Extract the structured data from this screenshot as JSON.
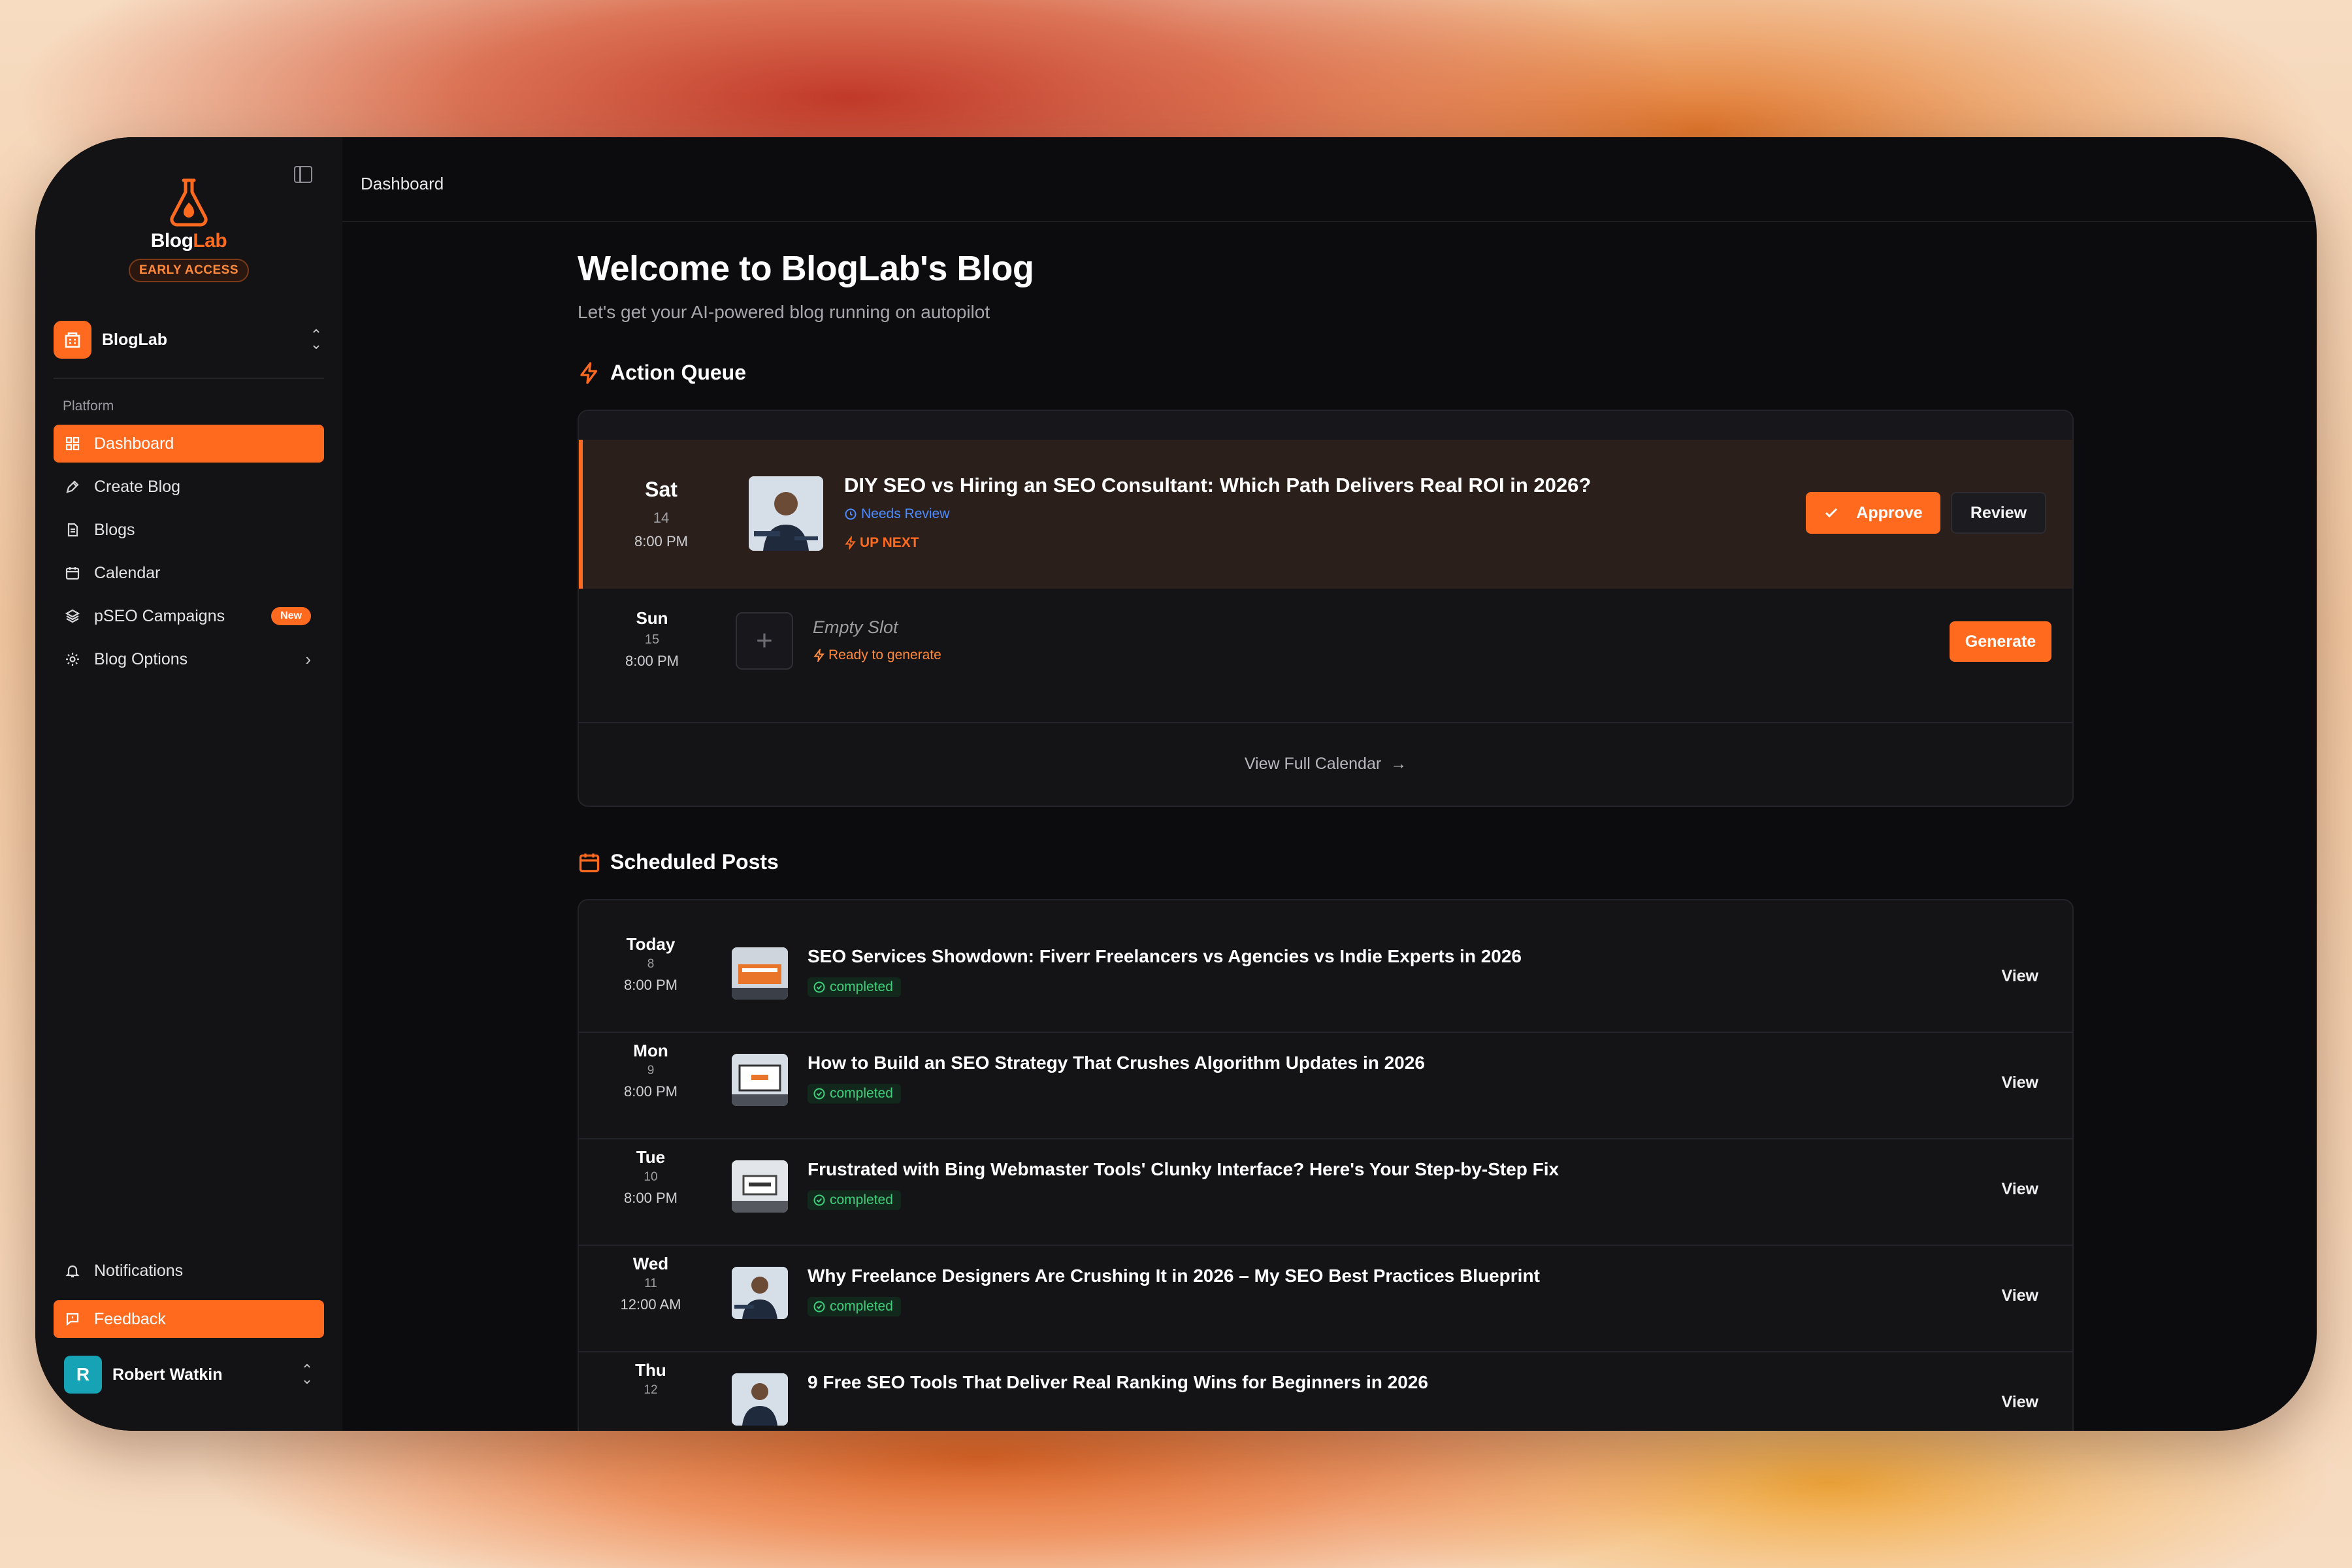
{
  "brand": {
    "part1": "Blog",
    "part2": "Lab",
    "badge": "EARLY ACCESS"
  },
  "workspace": {
    "name": "BlogLab"
  },
  "sidebar": {
    "section": "Platform",
    "items": [
      {
        "label": "Dashboard",
        "icon": "grid-icon",
        "active": true
      },
      {
        "label": "Create Blog",
        "icon": "pen-icon"
      },
      {
        "label": "Blogs",
        "icon": "document-icon"
      },
      {
        "label": "Calendar",
        "icon": "calendar-icon"
      },
      {
        "label": "pSEO Campaigns",
        "icon": "layers-icon",
        "badge": "New"
      },
      {
        "label": "Blog Options",
        "icon": "gear-icon"
      }
    ],
    "notifications": "Notifications",
    "feedback": "Feedback",
    "user": {
      "initial": "R",
      "name": "Robert Watkin"
    }
  },
  "breadcrumb": "Dashboard",
  "header": {
    "title": "Welcome to BlogLab's Blog",
    "subtitle": "Let's get your AI-powered blog running on autopilot"
  },
  "action_queue": {
    "title": "Action Queue",
    "upnext": {
      "day": "Sat",
      "date": "14",
      "time": "8:00 PM",
      "title": "DIY SEO vs Hiring an SEO Consultant: Which Path Delivers Real ROI in 2026?",
      "status": "Needs Review",
      "flag": "UP NEXT",
      "approve": "Approve",
      "review": "Review"
    },
    "empty": {
      "day": "Sun",
      "date": "15",
      "time": "8:00 PM",
      "title": "Empty Slot",
      "status": "Ready to generate",
      "generate": "Generate"
    },
    "view_calendar": "View Full Calendar"
  },
  "scheduled": {
    "title": "Scheduled Posts",
    "view_label": "View",
    "rows": [
      {
        "day": "Today",
        "date": "8",
        "time": "8:00 PM",
        "title": "SEO Services Showdown: Fiverr Freelancers vs Agencies vs Indie Experts in 2026",
        "status": "completed"
      },
      {
        "day": "Mon",
        "date": "9",
        "time": "8:00 PM",
        "title": "How to Build an SEO Strategy That Crushes Algorithm Updates in 2026",
        "status": "completed"
      },
      {
        "day": "Tue",
        "date": "10",
        "time": "8:00 PM",
        "title": "Frustrated with Bing Webmaster Tools' Clunky Interface? Here's Your Step-by-Step Fix",
        "status": "completed"
      },
      {
        "day": "Wed",
        "date": "11",
        "time": "12:00 AM",
        "title": "Why Freelance Designers Are Crushing It in 2026 – My SEO Best Practices Blueprint",
        "status": "completed"
      },
      {
        "day": "Thu",
        "date": "12",
        "time": "",
        "title": "9 Free SEO Tools That Deliver Real Ranking Wins for Beginners in 2026",
        "status": ""
      }
    ]
  },
  "colors": {
    "accent": "#ff6a1f",
    "success": "#3fcf7a",
    "info": "#4d8cff"
  }
}
